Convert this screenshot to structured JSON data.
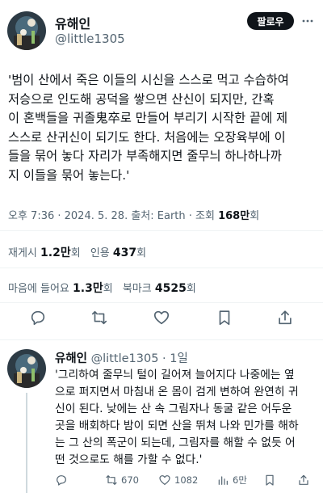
{
  "tweet": {
    "display_name": "유해인",
    "handle": "@little1305",
    "follow_label": "팔로우",
    "lines": [
      "'범이 산에서 죽은 이들의 시신을 스스로 먹고 수습하여",
      "저승으로 인도해 공덕을 쌓으면 산신이 되지만, 간혹",
      "이 혼백들을 귀졸鬼卒로 만들어 부리기 시작한 끝에 제",
      "스스로 산귀신이 되기도 한다. 처음에는 오장육부에 이",
      "들을 묶어 놓다 자리가 부족해지면 줄무늬 하나하나까",
      "지 이들을 묶어 놓는다.'"
    ],
    "meta_prefix": "오후 7:36 · 2024. 5. 28. 출처: Earth · 조회 ",
    "views": "168만",
    "views_suffix": "회"
  },
  "stats": {
    "repost_label": "재게시",
    "repost_count": "1.2만",
    "repost_suffix": "회",
    "quote_label": "인용",
    "quote_count": "437",
    "quote_suffix": "회",
    "like_label": "마음에 들어요",
    "like_count": "1.3만",
    "like_suffix": "회",
    "bookmark_label": "북마크",
    "bookmark_count": "4525",
    "bookmark_suffix": "회"
  },
  "actions": {
    "icons": [
      "reply-icon",
      "retweet-icon",
      "like-icon",
      "bookmark-icon",
      "share-icon"
    ]
  },
  "reply": {
    "display_name": "유해인",
    "handle_time": "@little1305 · 1일",
    "lines": [
      "'그리하여 줄무늬 털이 길어져 늘어지다 나중에는 옆",
      "으로 퍼지면서 마침내 온 몸이 검게 변하여 완연히 귀",
      "신이 된다. 낮에는 산 속 그림자나 동굴 같은 어두운",
      "곳을 배회하다 밤이 되면 산을 뛰쳐 나와 민가를 해하",
      "는 그 산의 폭군이 되는데, 그림자를 해할 수 없듯 어",
      "떤 것으로도 해를 가할 수 없다.'"
    ],
    "retweets": "670",
    "likes": "1082",
    "views": "6만"
  },
  "colors": {
    "text": "#0f1419",
    "muted": "#536471",
    "divider": "#eff3f4",
    "follow_bg": "#0f1419"
  }
}
